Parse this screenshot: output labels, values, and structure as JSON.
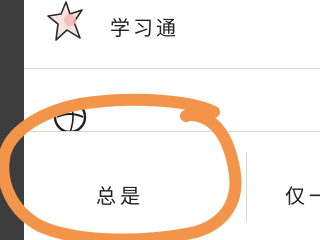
{
  "apps": [
    {
      "label": "学习通",
      "icon": "xuexitong-star-icon"
    },
    {
      "label": "",
      "icon": "circle-app-icon"
    }
  ],
  "actions": {
    "always_label": "总是",
    "once_label": "仅一"
  },
  "colors": {
    "backdrop": "#3d3d3d",
    "sheet": "#ffffff",
    "divider": "#d6d6d6",
    "text": "#222222",
    "annotation_marker": "#f2954a"
  }
}
